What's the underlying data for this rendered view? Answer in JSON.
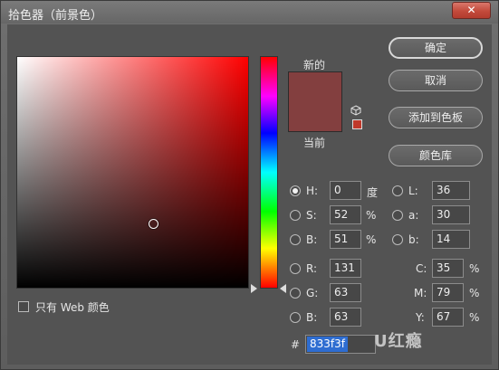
{
  "window": {
    "title": "拾色器（前景色）",
    "close_label": "✕"
  },
  "colors": {
    "new": "#833f3f",
    "current": "#833f3f",
    "gamut_warning": "#c0392b",
    "hex_selection_bg": "#2e6dd1"
  },
  "swatch": {
    "new_label": "新的",
    "current_label": "当前",
    "icon": "cube-icon"
  },
  "buttons": {
    "ok": "确定",
    "cancel": "取消",
    "add_to_swatches": "添加到色板",
    "color_libraries": "颜色库"
  },
  "web_only": {
    "label": "只有 Web 颜色",
    "checked": false
  },
  "hsb": {
    "h": {
      "label": "H:",
      "value": "0",
      "unit": "度",
      "selected": true
    },
    "s": {
      "label": "S:",
      "value": "52",
      "unit": "%",
      "selected": false
    },
    "b": {
      "label": "B:",
      "value": "51",
      "unit": "%",
      "selected": false
    }
  },
  "lab": {
    "l": {
      "label": "L:",
      "value": "36"
    },
    "a": {
      "label": "a:",
      "value": "30"
    },
    "b": {
      "label": "b:",
      "value": "14"
    }
  },
  "rgb": {
    "r": {
      "label": "R:",
      "value": "131"
    },
    "g": {
      "label": "G:",
      "value": "63"
    },
    "b": {
      "label": "B:",
      "value": "63"
    }
  },
  "cmyk": {
    "c": {
      "label": "C:",
      "value": "35",
      "unit": "%"
    },
    "m": {
      "label": "M:",
      "value": "79",
      "unit": "%"
    },
    "y": {
      "label": "Y:",
      "value": "67",
      "unit": "%"
    }
  },
  "hex": {
    "label": "#",
    "value": "833f3f"
  },
  "watermark": "U红瘾"
}
